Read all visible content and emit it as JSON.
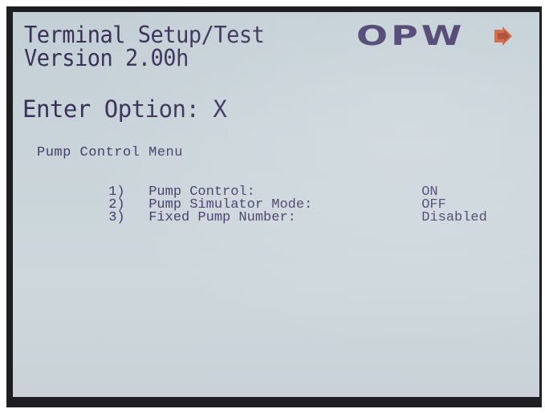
{
  "header": {
    "title": "Terminal Setup/Test",
    "version": "Version 2.00h"
  },
  "logo": {
    "text": "OPW",
    "icon": "arrow-right-icon",
    "color": "#453a6a",
    "accent": "#d0603a"
  },
  "prompt": {
    "text": "Enter Option: X"
  },
  "menu": {
    "title": "Pump Control Menu",
    "items": [
      {
        "number": "1)",
        "label": "Pump Control:",
        "value": "ON"
      },
      {
        "number": "2)",
        "label": "Pump Simulator Mode:",
        "value": "OFF"
      },
      {
        "number": "3)",
        "label": "Fixed Pump Number:",
        "value": "Disabled"
      }
    ]
  },
  "colors": {
    "screen_bg": "#c9d4da",
    "text": "#3a3058",
    "bezel": "#1e1e22"
  }
}
